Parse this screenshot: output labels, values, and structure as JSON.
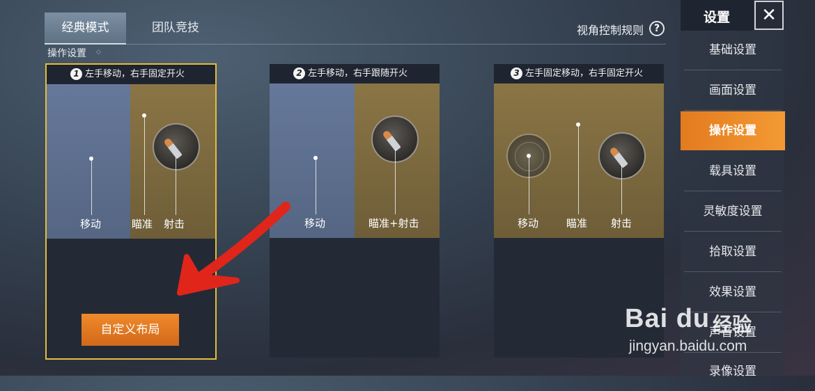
{
  "tabs": [
    {
      "label": "经典模式",
      "active": true
    },
    {
      "label": "团队竞技",
      "active": false
    }
  ],
  "header": {
    "view_control_rules": "视角控制规则",
    "help_icon": "question-circle-icon"
  },
  "section": {
    "title": "操作设置"
  },
  "cards": [
    {
      "number": "1",
      "title": "左手移动，右手固定开火",
      "labels": {
        "move": "移动",
        "aim": "瞄准",
        "shoot": "射击"
      },
      "selected": true
    },
    {
      "number": "2",
      "title": "左手移动，右手跟随开火",
      "labels": {
        "move": "移动",
        "aim_shoot": "瞄准+射击"
      },
      "selected": false
    },
    {
      "number": "3",
      "title": "左手固定移动，右手固定开火",
      "labels": {
        "move": "移动",
        "aim": "瞄准",
        "shoot": "射击"
      },
      "selected": false
    }
  ],
  "custom_layout_button": "自定义布局",
  "sidebar": {
    "title": "设置",
    "close_icon": "✕",
    "items": [
      {
        "label": "基础设置",
        "active": false
      },
      {
        "label": "画面设置",
        "active": false
      },
      {
        "label": "操作设置",
        "active": true
      },
      {
        "label": "载具设置",
        "active": false
      },
      {
        "label": "灵敏度设置",
        "active": false
      },
      {
        "label": "拾取设置",
        "active": false
      },
      {
        "label": "效果设置",
        "active": false
      },
      {
        "label": "声音设置",
        "active": false
      },
      {
        "label": "录像设置",
        "active": false
      }
    ]
  },
  "watermark": {
    "logo": "Bai du",
    "brand": "经验",
    "url": "jingyan.baidu.com"
  },
  "colors": {
    "accent": "#ef8a2a",
    "selected_border": "#e5bd3a",
    "annotation": "#e0251b"
  }
}
